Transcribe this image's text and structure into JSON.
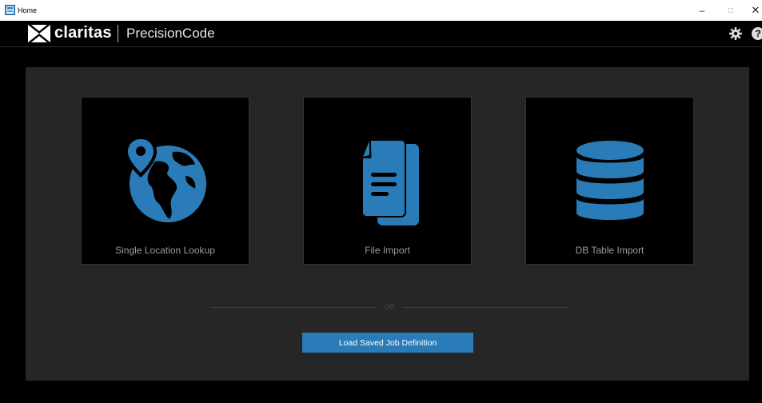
{
  "window": {
    "title": "Home",
    "minimize": "–",
    "maximize": "□",
    "close": "✕"
  },
  "header": {
    "brand": "claritas",
    "product": "PrecisionCode",
    "help": "?"
  },
  "tiles": [
    {
      "label": "Single Location Lookup",
      "icon": "globe-pin-icon"
    },
    {
      "label": "File Import",
      "icon": "document-icon"
    },
    {
      "label": "DB Table Import",
      "icon": "database-icon"
    }
  ],
  "separator": {
    "text": "OR"
  },
  "load_button": {
    "label": "Load Saved Job Definition"
  },
  "colors": {
    "accent": "#2a7cb8",
    "background": "#000000",
    "panel": "#262626"
  }
}
